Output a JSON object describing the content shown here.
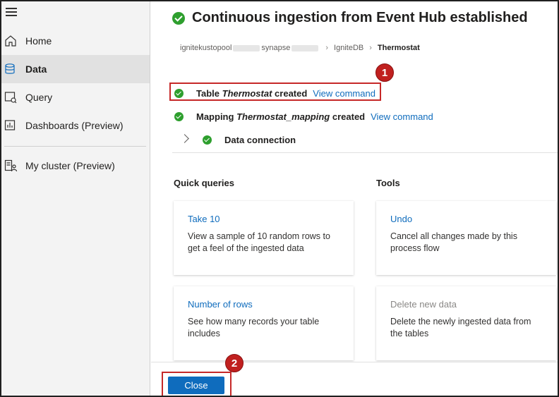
{
  "sidebar": {
    "items": [
      {
        "label": "Home",
        "icon": "home-icon"
      },
      {
        "label": "Data",
        "icon": "database-icon",
        "active": true
      },
      {
        "label": "Query",
        "icon": "query-icon"
      },
      {
        "label": "Dashboards (Preview)",
        "icon": "dashboard-icon"
      },
      {
        "label": "My cluster (Preview)",
        "icon": "cluster-icon"
      }
    ]
  },
  "header": {
    "title": "Continuous ingestion from Event Hub established"
  },
  "breadcrumb": {
    "cluster": "ignitekustopool",
    "workspace": "synapse",
    "database": "IgniteDB",
    "table": "Thermostat"
  },
  "steps": {
    "table": {
      "prefix": "Table",
      "name": "Thermostat",
      "suffix": "created",
      "link": "View command"
    },
    "mapping": {
      "prefix": "Mapping",
      "name": "Thermostat_mapping",
      "suffix": "created",
      "link": "View command"
    },
    "connection": {
      "label": "Data connection"
    }
  },
  "quick_queries": {
    "title": "Quick queries",
    "cards": [
      {
        "title": "Take 10",
        "desc": "View a sample of 10 random rows to get a feel of the ingested data"
      },
      {
        "title": "Number of rows",
        "desc": "See how many records your table includes"
      }
    ]
  },
  "tools": {
    "title": "Tools",
    "cards": [
      {
        "title": "Undo",
        "desc": "Cancel all changes made by this process flow"
      },
      {
        "title": "Delete new data",
        "desc": "Delete the newly ingested data from the tables"
      }
    ]
  },
  "footer": {
    "close_label": "Close"
  },
  "annotations": {
    "badge1": "1",
    "badge2": "2"
  },
  "colors": {
    "accent": "#0f6cbd",
    "success": "#2e9f2e",
    "callout": "#c62828"
  }
}
